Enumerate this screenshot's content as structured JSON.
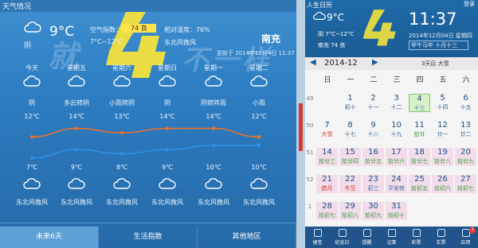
{
  "weather": {
    "window_title": "天气情况",
    "current": {
      "icon": "cloudy-icon",
      "desc": "阴",
      "temp": "9°C",
      "range": "7°C~12°C",
      "aqi_label": "空气指数：",
      "aqi_value": "74 良",
      "humidity": "相对湿度：76%",
      "wind": "东北风微风",
      "city": "南充",
      "updated": "更新于 2014年12月4日 11:37"
    },
    "days": [
      {
        "name": "今天",
        "desc": "阴",
        "hi": "12℃",
        "lo": "7℃",
        "wind": "东北风微风"
      },
      {
        "name": "星期五",
        "desc": "多云转阴",
        "hi": "14℃",
        "lo": "9℃",
        "wind": "东北风微风"
      },
      {
        "name": "星期六",
        "desc": "小雨转阴",
        "hi": "13℃",
        "lo": "8℃",
        "wind": "东北风微风"
      },
      {
        "name": "星期日",
        "desc": "阴",
        "hi": "14℃",
        "lo": "9℃",
        "wind": "东北风微风"
      },
      {
        "name": "星期一",
        "desc": "阴转阵雨",
        "hi": "14℃",
        "lo": "10℃",
        "wind": "东北风微风"
      },
      {
        "name": "星期二",
        "desc": "小雨",
        "hi": "12℃",
        "lo": "10℃",
        "wind": "东北风微风"
      }
    ],
    "tabs": [
      "未来6天",
      "生活指数",
      "其他地区"
    ],
    "watermark": "就4不一样"
  },
  "chart_data": {
    "type": "line",
    "categories": [
      "今天",
      "星期五",
      "星期六",
      "星期日",
      "星期一",
      "星期二"
    ],
    "series": [
      {
        "values": [
          12,
          14,
          13,
          14,
          14,
          12
        ],
        "color": "#e8702a"
      },
      {
        "values": [
          7,
          9,
          8,
          9,
          10,
          10
        ],
        "color": "#2f8fe6"
      }
    ]
  },
  "calendar": {
    "title": "人生日历",
    "top_buttons": "登录",
    "temp": "9°C",
    "range": "阴 7°C~12°C",
    "city": "南充 74 良",
    "time": "11:37",
    "date": "2014年12月04日 星期四",
    "lunar": "甲午马年 十月十三",
    "year_month": "2014-12",
    "countdown": "3天后 大雪",
    "weekdays": [
      "日",
      "一",
      "二",
      "三",
      "四",
      "五",
      "六"
    ],
    "weeks": [
      {
        "num": "49",
        "cells": [
          null,
          {
            "n": "1",
            "l": "初十"
          },
          {
            "n": "2",
            "l": "十一"
          },
          {
            "n": "3",
            "l": "十二"
          },
          {
            "n": "4",
            "l": "十三",
            "today": true
          },
          {
            "n": "5",
            "l": "十四"
          },
          {
            "n": "6",
            "l": "十五"
          }
        ]
      },
      {
        "num": "50",
        "cells": [
          {
            "n": "7",
            "l": "大雪",
            "red": true
          },
          {
            "n": "8",
            "l": "十七"
          },
          {
            "n": "9",
            "l": "十八"
          },
          {
            "n": "10",
            "l": "十九"
          },
          {
            "n": "11",
            "l": "拾廿",
            "green": true
          },
          {
            "n": "12",
            "l": "廿一"
          },
          {
            "n": "13",
            "l": "廿二"
          }
        ]
      },
      {
        "num": "51",
        "cells": [
          {
            "n": "14",
            "l": "拾廿三",
            "green": true,
            "pink": true
          },
          {
            "n": "15",
            "l": "拾廿四",
            "green": true,
            "pink": true
          },
          {
            "n": "16",
            "l": "拾廿五",
            "green": true,
            "pink": true
          },
          {
            "n": "17",
            "l": "拾廿六",
            "green": true,
            "pink": true
          },
          {
            "n": "18",
            "l": "拾廿七",
            "green": true,
            "pink": true
          },
          {
            "n": "19",
            "l": "拾廿八",
            "green": true,
            "pink": true
          },
          {
            "n": "20",
            "l": "拾廿九",
            "green": true,
            "pink": true
          }
        ]
      },
      {
        "num": "52",
        "cells": [
          {
            "n": "21",
            "l": "腊月",
            "red": true,
            "pink": true
          },
          {
            "n": "22",
            "l": "冬至",
            "red": true,
            "pink": true
          },
          {
            "n": "23",
            "l": "初三",
            "pink": true
          },
          {
            "n": "24",
            "l": "平安夜",
            "pink": true
          },
          {
            "n": "25",
            "l": "拾初五",
            "green": true,
            "pink": true
          },
          {
            "n": "26",
            "l": "拾初六",
            "green": true,
            "pink": true
          },
          {
            "n": "27",
            "l": "拾初七",
            "green": true,
            "pink": true
          }
        ]
      },
      {
        "num": "1",
        "cells": [
          {
            "n": "28",
            "l": "拾初七",
            "green": true,
            "pink": true
          },
          {
            "n": "29",
            "l": "拾初八",
            "green": true,
            "pink": true
          },
          {
            "n": "30",
            "l": "拾初九",
            "green": true,
            "pink": true
          },
          {
            "n": "31",
            "l": "拾初十",
            "green": true,
            "pink": true
          },
          null,
          null,
          null
        ]
      }
    ],
    "bottom": [
      "便签",
      "纪念日",
      "提醒",
      "记事",
      "彩票",
      "车票",
      "应用"
    ],
    "bottom_badge": "7"
  }
}
